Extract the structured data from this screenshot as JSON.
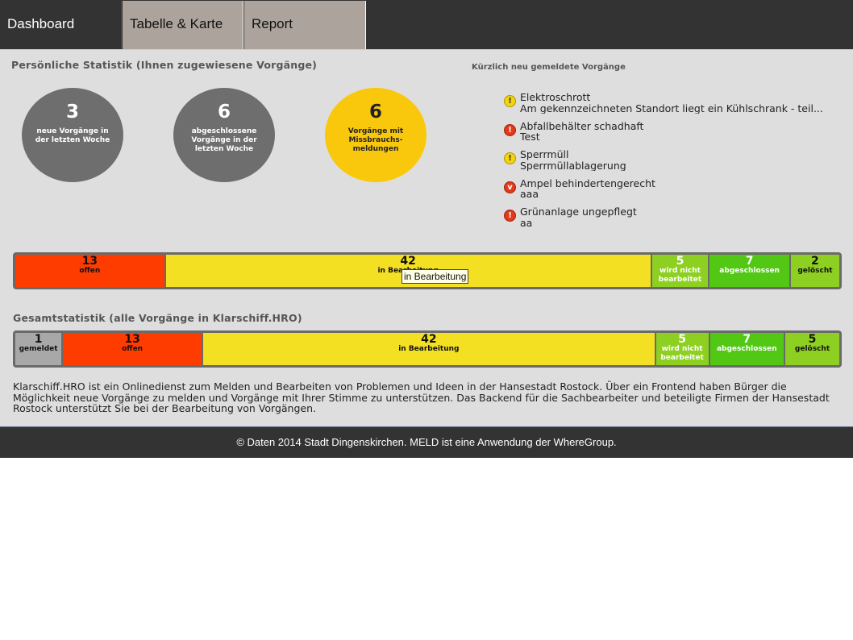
{
  "nav": {
    "tabs": [
      {
        "label": "Dashboard"
      },
      {
        "label": "Tabelle & Karte"
      },
      {
        "label": "Report"
      }
    ]
  },
  "personal": {
    "title": "Persönliche Statistik (Ihnen zugewiesene Vorgänge)",
    "circles": [
      {
        "value": "3",
        "label": "neue Vorgänge in der letzten Woche"
      },
      {
        "value": "6",
        "label": "abgeschlossene Vorgänge in der letzten Woche"
      },
      {
        "value": "6",
        "label": "Vorgänge mit Missbrauchs-meldungen"
      }
    ]
  },
  "recent": {
    "title": "Kürzlich neu gemeldete Vorgänge",
    "items": [
      {
        "icon": "warning-icon",
        "icon_char": "!",
        "title": "Elektroschrott",
        "desc": "Am gekennzeichneten Standort liegt ein Kühlschrank - teil..."
      },
      {
        "icon": "alert-icon",
        "icon_char": "!",
        "title": "Abfallbehälter schadhaft",
        "desc": "Test"
      },
      {
        "icon": "warning-icon",
        "icon_char": "!",
        "title": "Sperrmüll",
        "desc": "Sperrmüllablagerung"
      },
      {
        "icon": "down-alert-icon",
        "icon_char": "v",
        "title": "Ampel behindertengerecht",
        "desc": "aaa"
      },
      {
        "icon": "alert-icon",
        "icon_char": "!",
        "title": "Grünanlage ungepflegt",
        "desc": "aa"
      }
    ]
  },
  "personal_bar": [
    {
      "value": "13",
      "label": "offen",
      "share": 13,
      "color": "#ff3c00"
    },
    {
      "value": "42",
      "label": "in Bearbeitung",
      "share": 42,
      "color": "#f4e022"
    },
    {
      "value": "5",
      "label": "wird nicht bearbeitet",
      "share": 5,
      "color": "#8ed022"
    },
    {
      "value": "7",
      "label": "abgeschlossen",
      "share": 7,
      "color": "#52c814"
    },
    {
      "value": "2",
      "label": "gelöscht",
      "share": 2,
      "color": "#8ed022"
    }
  ],
  "tooltip": "in Bearbeitung",
  "overall": {
    "title": "Gesamtstatistik (alle Vorgänge in Klarschiff.HRO)",
    "bar": [
      {
        "value": "1",
        "label": "gemeldet",
        "share": 1,
        "color": "#a8a8a8"
      },
      {
        "value": "13",
        "label": "offen",
        "share": 13,
        "color": "#ff3c00"
      },
      {
        "value": "42",
        "label": "in Bearbeitung",
        "share": 42,
        "color": "#f4e022"
      },
      {
        "value": "5",
        "label": "wird nicht bearbeitet",
        "share": 5,
        "color": "#8ed022"
      },
      {
        "value": "7",
        "label": "abgeschlossen",
        "share": 7,
        "color": "#52c814"
      },
      {
        "value": "5",
        "label": "gelöscht",
        "share": 5,
        "color": "#8ed022"
      }
    ]
  },
  "description": "Klarschiff.HRO ist ein Onlinedienst zum Melden und Bearbeiten von Problemen und Ideen in der Hansestadt Rostock. Über ein Frontend haben Bürger die Möglichkeit neue Vorgänge zu melden und Vorgänge mit Ihrer Stimme zu unterstützen. Das Backend für die Sachbearbeiter und beteiligte Firmen der Hansestadt Rostock unterstützt Sie bei der Bearbeitung von Vorgängen.",
  "footer": "© Daten 2014 Stadt Dingenskirchen. MELD ist eine Anwendung der WhereGroup."
}
